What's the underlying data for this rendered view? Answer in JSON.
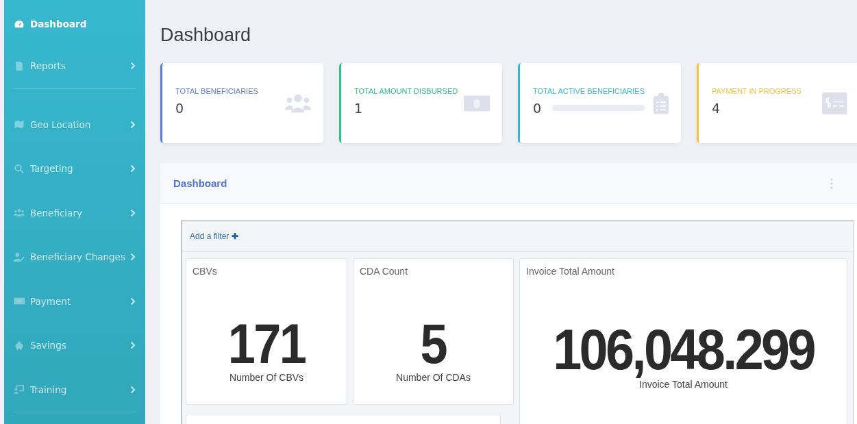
{
  "sidebar": {
    "items": [
      {
        "label": "Dashboard",
        "kind": "gauge",
        "selected": true,
        "has_submenu": false
      },
      {
        "label": "Reports",
        "kind": "file",
        "selected": false,
        "has_submenu": true
      },
      {
        "label": "Geo Location",
        "kind": "map",
        "selected": false,
        "has_submenu": true
      },
      {
        "label": "Targeting",
        "kind": "search",
        "selected": false,
        "has_submenu": true
      },
      {
        "label": "Beneficiary",
        "kind": "users",
        "selected": false,
        "has_submenu": true
      },
      {
        "label": "Beneficiary Changes",
        "kind": "useredit",
        "selected": false,
        "has_submenu": true
      },
      {
        "label": "Payment",
        "kind": "money",
        "selected": false,
        "has_submenu": true
      },
      {
        "label": "Savings",
        "kind": "piggy",
        "selected": false,
        "has_submenu": true
      },
      {
        "label": "Training",
        "kind": "board",
        "selected": false,
        "has_submenu": true
      }
    ]
  },
  "page_title": "Dashboard",
  "stats": [
    {
      "label": "TOTAL BENEFICIARIES",
      "value": "0",
      "color": "#5b7be0",
      "kind": "users"
    },
    {
      "label": "TOTAL AMOUNT DISBURSED",
      "value": "1",
      "color": "#2fc383",
      "kind": "money"
    },
    {
      "label": "TOTAL ACTIVE BENEFICIARIES",
      "value": "0",
      "color": "#36b9cc",
      "kind": "clipboard",
      "level": 0
    },
    {
      "label": "PAYMENT IN PROGRESS",
      "value": "4",
      "color": "#f6c23e",
      "kind": "bill"
    }
  ],
  "panel": {
    "title": "Dashboard",
    "filter_link": "Add a filter",
    "filter_icon": "✚",
    "tiles": [
      {
        "title": "CBVs",
        "value": "171",
        "caption": "Number Of CBVs"
      },
      {
        "title": "CDA Count",
        "value": "5",
        "caption": "Number Of CDAs"
      },
      {
        "title": "Invoice Total Amount",
        "value": "106,048.299",
        "caption": "Invoice Total Amount"
      }
    ]
  }
}
